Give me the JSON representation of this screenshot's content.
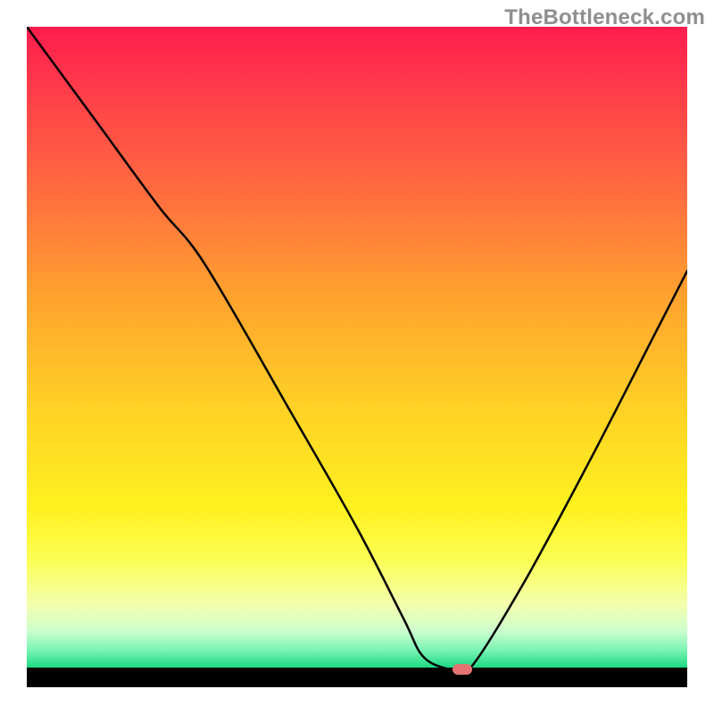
{
  "watermark": "TheBottleneck.com",
  "colors": {
    "gradient_top": "#ff1c4e",
    "gradient_mid": "#ffd325",
    "gradient_bottom": "#14d77d",
    "frame_bg": "#000000",
    "curve": "#000000",
    "marker": "#e57373",
    "watermark_text": "#8f8f8f"
  },
  "chart_data": {
    "type": "line",
    "title": "",
    "xlabel": "",
    "ylabel": "",
    "xlim": [
      0,
      100
    ],
    "ylim": [
      0,
      100
    ],
    "grid": false,
    "legend_position": "none",
    "series": [
      {
        "name": "bottleneck-curve",
        "x": [
          0,
          10,
          20,
          27,
          40,
          50,
          57,
          60,
          64,
          67,
          75,
          85,
          95,
          100
        ],
        "values": [
          100,
          86,
          72,
          63,
          40,
          22,
          8,
          2,
          0,
          0,
          13,
          32,
          52,
          62
        ]
      }
    ],
    "annotations": [
      {
        "name": "trough-marker",
        "x": 66,
        "y": 0
      }
    ],
    "notes": "Y represents bottleneck severity (0 = ideal, 100 = worst). Curve falls from top-left, flattens at x≈60–68, then rises toward the right."
  }
}
